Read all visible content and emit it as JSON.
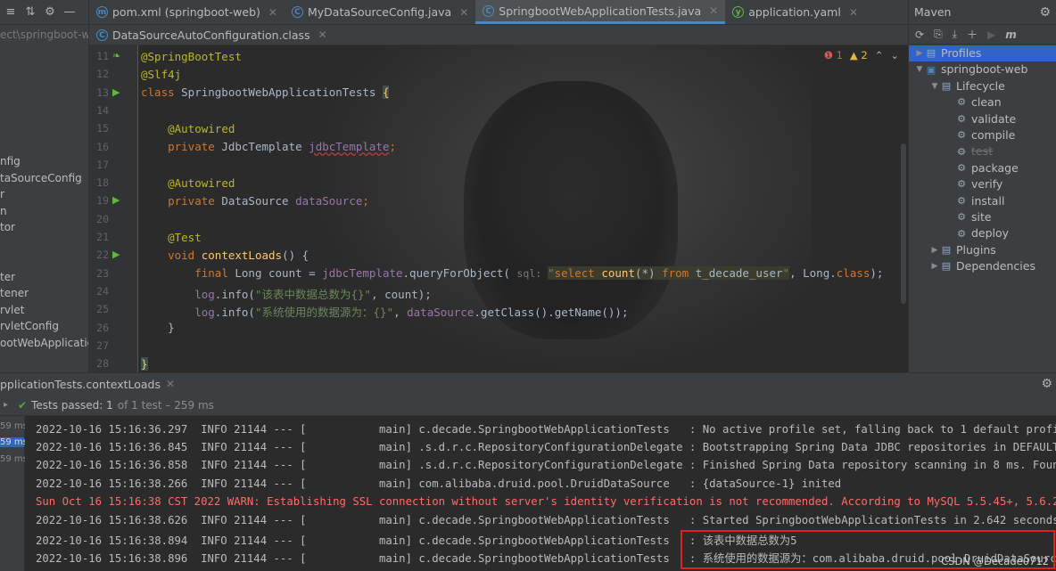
{
  "left_panel": {
    "toolbar_icons": [
      "align-icon",
      "collapse-icon",
      "gear-icon",
      "hide-icon"
    ],
    "path": "ect\\springboot-we",
    "items": [
      "nfig",
      "taSourceConfig",
      "r",
      "n",
      "tor",
      "",
      "",
      "ter",
      "tener",
      "rvlet",
      "rvletConfig",
      "ootWebApplication"
    ]
  },
  "tabs": [
    {
      "label": "pom.xml (springboot-web)",
      "icon": "maven-icon",
      "color": "#4a88c7",
      "glyph": "m",
      "active": false
    },
    {
      "label": "MyDataSourceConfig.java",
      "icon": "class-icon",
      "color": "#4a88c7",
      "glyph": "C",
      "active": false
    },
    {
      "label": "SpringbootWebApplicationTests.java",
      "icon": "class-icon",
      "color": "#4a88c7",
      "glyph": "C",
      "active": true
    },
    {
      "label": "application.yaml",
      "icon": "yaml-icon",
      "color": "#62b543",
      "glyph": "y",
      "active": false
    }
  ],
  "tabs_row2": [
    {
      "label": "DataSourceAutoConfiguration.class",
      "icon": "class-icon",
      "color": "#4a88c7",
      "glyph": "C"
    }
  ],
  "editor": {
    "error_count": "1",
    "warning_count": "2",
    "line_numbers": [
      "11",
      "12",
      "13",
      "14",
      "15",
      "16",
      "17",
      "18",
      "19",
      "20",
      "21",
      "22",
      "23",
      "24",
      "25",
      "26",
      "27",
      "28"
    ],
    "lines": {
      "l11": "@SpringBootTest",
      "l12": "@Slf4j",
      "l13_kw": "class ",
      "l13_name": "SpringbootWebApplicationTests ",
      "l13_brace": "{",
      "l15": "@Autowired",
      "l16_kw": "private ",
      "l16_type": "JdbcTemplate ",
      "l16_field": "jdbcTemplate",
      "l16_semi": ";",
      "l18": "@Autowired",
      "l19_kw": "private ",
      "l19_type": "DataSource ",
      "l19_field": "dataSource",
      "l19_semi": ";",
      "l21": "@Test",
      "l22_kw": "void ",
      "l22_fn": "contextLoads",
      "l22_rest": "() {",
      "l23_kw": "final ",
      "l23_a": "Long count = ",
      "l23_field": "jdbcTemplate",
      "l23_b": ".queryForObject( ",
      "l23_hint": "sql: ",
      "l23_s1": "\"",
      "l23_sql_kw1": "select ",
      "l23_sql_fn": "count",
      "l23_sql_p": "(*) ",
      "l23_sql_kw2": "from ",
      "l23_sql_t": "t_decade_user",
      "l23_s2": "\"",
      "l23_c": ", Long.",
      "l23_kw2": "class",
      "l23_d": ");",
      "l24_field": "log",
      "l24_a": ".info(",
      "l24_str": "\"该表中数据总数为{}\"",
      "l24_b": ", count);",
      "l25_field": "log",
      "l25_a": ".info(",
      "l25_str": "\"系统使用的数据源为：{}\"",
      "l25_b": ", ",
      "l25_field2": "dataSource",
      "l25_c": ".getClass().getName());",
      "l26": "}",
      "l28": "}"
    }
  },
  "maven": {
    "title": "Maven",
    "toolbar_icons": [
      "reload-icon",
      "add-source-icon",
      "download-icon",
      "plus-icon",
      "run-icon",
      "maven-m-icon"
    ],
    "tree": [
      {
        "label": "Profiles",
        "level": 0,
        "arrow": "▶",
        "icon": "folder",
        "selected": true
      },
      {
        "label": "springboot-web",
        "level": 0,
        "arrow": "▼",
        "icon": "module",
        "selected": false
      },
      {
        "label": "Lifecycle",
        "level": 1,
        "arrow": "▼",
        "icon": "folder",
        "selected": false
      },
      {
        "label": "clean",
        "level": 2,
        "arrow": "",
        "icon": "gear",
        "selected": false
      },
      {
        "label": "validate",
        "level": 2,
        "arrow": "",
        "icon": "gear",
        "selected": false
      },
      {
        "label": "compile",
        "level": 2,
        "arrow": "",
        "icon": "gear",
        "selected": false
      },
      {
        "label": "test",
        "level": 2,
        "arrow": "",
        "icon": "gear",
        "selected": false,
        "dim": true
      },
      {
        "label": "package",
        "level": 2,
        "arrow": "",
        "icon": "gear",
        "selected": false
      },
      {
        "label": "verify",
        "level": 2,
        "arrow": "",
        "icon": "gear",
        "selected": false
      },
      {
        "label": "install",
        "level": 2,
        "arrow": "",
        "icon": "gear",
        "selected": false
      },
      {
        "label": "site",
        "level": 2,
        "arrow": "",
        "icon": "gear",
        "selected": false
      },
      {
        "label": "deploy",
        "level": 2,
        "arrow": "",
        "icon": "gear",
        "selected": false
      },
      {
        "label": "Plugins",
        "level": 1,
        "arrow": "▶",
        "icon": "folder",
        "selected": false
      },
      {
        "label": "Dependencies",
        "level": 1,
        "arrow": "▶",
        "icon": "folder",
        "selected": false
      }
    ]
  },
  "run": {
    "title": "pplicationTests.contextLoads",
    "status_passed": "Tests passed: 1",
    "status_rest": "of 1 test – 259 ms",
    "side_times": [
      "59 ms",
      "59 ms",
      "59 ms"
    ],
    "logs": [
      "2022-10-16 15:16:36.297  INFO 21144 --- [           main] c.decade.SpringbootWebApplicationTests   : No active profile set, falling back to 1 default profi",
      "2022-10-16 15:16:36.845  INFO 21144 --- [           main] .s.d.r.c.RepositoryConfigurationDelegate : Bootstrapping Spring Data JDBC repositories in DEFAULT",
      "2022-10-16 15:16:36.858  INFO 21144 --- [           main] .s.d.r.c.RepositoryConfigurationDelegate : Finished Spring Data repository scanning in 8 ms. Foun",
      "2022-10-16 15:16:38.266  INFO 21144 --- [           main] com.alibaba.druid.pool.DruidDataSource   : {dataSource-1} inited",
      "Sun Oct 16 15:16:38 CST 2022 WARN: Establishing SSL connection without server's identity verification is not recommended. According to MySQL 5.5.45+, 5.6.2",
      "2022-10-16 15:16:38.626  INFO 21144 --- [           main] c.decade.SpringbootWebApplicationTests   : Started SpringbootWebApplicationTests in 2.642 seconds",
      "2022-10-16 15:16:38.894  INFO 21144 --- [           main] c.decade.SpringbootWebApplicationTests   : 该表中数据总数为5",
      "2022-10-16 15:16:38.896  INFO 21144 --- [           main] c.decade.SpringbootWebApplicationTests   : 系统使用的数据源为：com.alibaba.druid.pool.DruidDataSource"
    ],
    "watermark": "CSDN @Decade0712"
  }
}
